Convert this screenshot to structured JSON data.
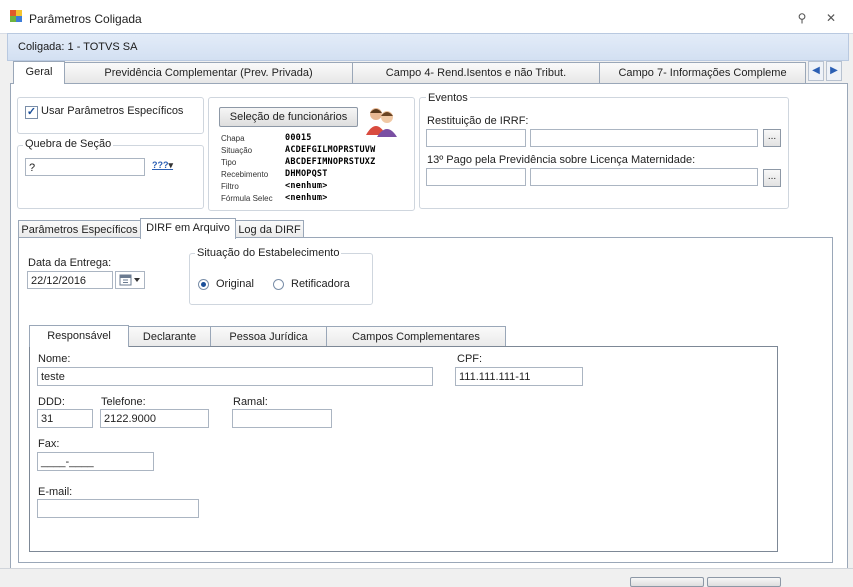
{
  "window": {
    "title": "Parâmetros Coligada",
    "pin_glyph": "⚲",
    "close_glyph": "✕"
  },
  "coligada_bar": {
    "text": "Coligada: 1 - TOTVS SA"
  },
  "top_tabs": [
    {
      "label": "Geral"
    },
    {
      "label": "Previdência Complementar (Prev. Privada)"
    },
    {
      "label": "Campo 4- Rend.Isentos e não Tribut."
    },
    {
      "label": "Campo 7- Informações Compleme"
    }
  ],
  "top_tab_scroll": {
    "left": "◀",
    "right": "▶"
  },
  "geral": {
    "usar_parametros": {
      "label": "Usar Parâmetros Específicos",
      "checked": true
    },
    "quebra_secao": {
      "title": "Quebra de Seção",
      "value": "?",
      "mask": "???"
    },
    "selecao": {
      "button_label": "Seleção de funcionários",
      "fields": [
        {
          "label": "Chapa",
          "value": "00015"
        },
        {
          "label": "Situação",
          "value": "ACDEFGILMOPRSTUVW"
        },
        {
          "label": "Tipo",
          "value": "ABCDEFIMNOPRSTUXZ"
        },
        {
          "label": "Recebimento",
          "value": "DHMOPQST"
        },
        {
          "label": "Filtro",
          "value": "<nenhum>"
        },
        {
          "label": "Fórmula Selec",
          "value": "<nenhum>"
        }
      ]
    },
    "eventos": {
      "title": "Eventos",
      "restituicao_label": "Restituição de IRRF:",
      "decimo_label": "13º Pago pela Previdência sobre Licença Maternidade:",
      "ellipsis": "..."
    }
  },
  "sub_tabs": [
    {
      "label": "Parâmetros Específicos"
    },
    {
      "label": "DIRF em Arquivo"
    },
    {
      "label": "Log da DIRF"
    }
  ],
  "dirf": {
    "data_entrega": {
      "label": "Data da Entrega:",
      "value": "22/12/2016"
    },
    "situacao": {
      "title": "Situação do Estabelecimento",
      "options": [
        {
          "label": "Original",
          "selected": true
        },
        {
          "label": "Retificadora",
          "selected": false
        }
      ]
    },
    "inner_tabs": [
      {
        "label": "Responsável"
      },
      {
        "label": "Declarante"
      },
      {
        "label": "Pessoa Jurídica"
      },
      {
        "label": "Campos Complementares"
      }
    ],
    "responsavel": {
      "nome": {
        "label": "Nome:",
        "value": "teste"
      },
      "cpf": {
        "label": "CPF:",
        "value": "111.111.111-11"
      },
      "ddd": {
        "label": "DDD:",
        "value": "31"
      },
      "telefone": {
        "label": "Telefone:",
        "value": "2122.9000"
      },
      "ramal": {
        "label": "Ramal:",
        "value": ""
      },
      "fax": {
        "label": "Fax:",
        "value": "____-____"
      },
      "email": {
        "label": "E-mail:",
        "value": ""
      }
    }
  }
}
